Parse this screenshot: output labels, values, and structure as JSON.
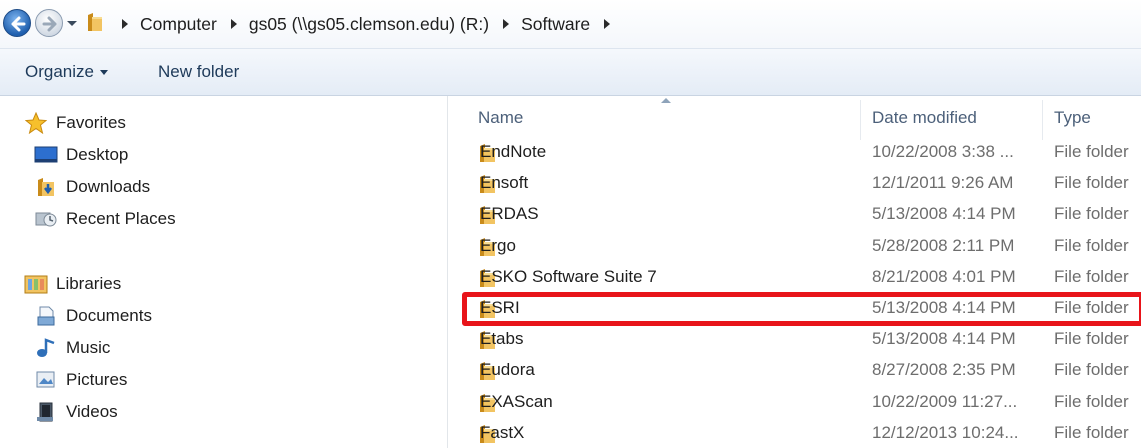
{
  "address_bar": {
    "crumbs": [
      "Computer",
      "gs05 (\\\\gs05.clemson.edu) (R:)",
      "Software"
    ],
    "icons": {
      "back": "back-arrow-icon",
      "forward": "forward-arrow-icon",
      "recent": "chevron-down-icon",
      "location": "folder-icon"
    }
  },
  "toolbar": {
    "organize_label": "Organize",
    "new_folder_label": "New folder"
  },
  "nav_pane": {
    "favorites": {
      "label": "Favorites",
      "items": [
        {
          "label": "Desktop",
          "icon": "desktop-icon"
        },
        {
          "label": "Downloads",
          "icon": "downloads-icon"
        },
        {
          "label": "Recent Places",
          "icon": "recent-places-icon"
        }
      ]
    },
    "libraries": {
      "label": "Libraries",
      "items": [
        {
          "label": "Documents",
          "icon": "documents-icon"
        },
        {
          "label": "Music",
          "icon": "music-icon"
        },
        {
          "label": "Pictures",
          "icon": "pictures-icon"
        },
        {
          "label": "Videos",
          "icon": "videos-icon"
        }
      ]
    }
  },
  "file_list": {
    "columns": {
      "name": "Name",
      "date": "Date modified",
      "type": "Type"
    },
    "rows": [
      {
        "name": "EndNote",
        "date": "10/22/2008 3:38 ...",
        "type": "File folder"
      },
      {
        "name": "Ensoft",
        "date": "12/1/2011 9:26 AM",
        "type": "File folder"
      },
      {
        "name": "ERDAS",
        "date": "5/13/2008 4:14 PM",
        "type": "File folder"
      },
      {
        "name": "Ergo",
        "date": "5/28/2008 2:11 PM",
        "type": "File folder"
      },
      {
        "name": "ESKO Software Suite 7",
        "date": "8/21/2008 4:01 PM",
        "type": "File folder"
      },
      {
        "name": "ESRI",
        "date": "5/13/2008 4:14 PM",
        "type": "File folder"
      },
      {
        "name": "Etabs",
        "date": "5/13/2008 4:14 PM",
        "type": "File folder"
      },
      {
        "name": "Eudora",
        "date": "8/27/2008 2:35 PM",
        "type": "File folder"
      },
      {
        "name": "EXAScan",
        "date": "10/22/2009 11:27...",
        "type": "File folder"
      },
      {
        "name": "FastX",
        "date": "12/12/2013 10:24...",
        "type": "File folder"
      }
    ],
    "highlighted_row": "ESRI",
    "highlight_color": "#e8141a"
  }
}
